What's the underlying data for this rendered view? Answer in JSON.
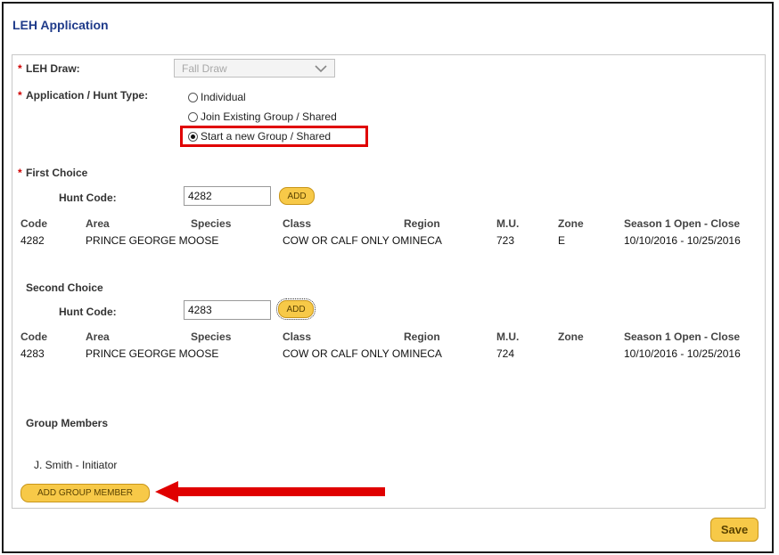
{
  "app": {
    "title": "LEH Application"
  },
  "form": {
    "required_marker": "*",
    "draw": {
      "label": "LEH Draw:",
      "value": "Fall Draw"
    },
    "hunt_type": {
      "label": "Application / Hunt Type:",
      "options": [
        {
          "label": "Individual",
          "selected": false
        },
        {
          "label": "Join Existing Group / Shared",
          "selected": false
        },
        {
          "label": "Start a new Group / Shared",
          "selected": true
        }
      ]
    }
  },
  "table_headers": [
    "Code",
    "Area",
    "Species",
    "Class",
    "Region",
    "M.U.",
    "Zone"
  ],
  "season_header": {
    "prefix": "Season ",
    "number": "1",
    "suffix": " Open - Close"
  },
  "first_choice": {
    "title": "First Choice",
    "hunt_code_label": "Hunt Code:",
    "hunt_code_value": "4282",
    "add_label": "ADD",
    "row": {
      "code": "4282",
      "area_species": "PRINCE GEORGE MOOSE",
      "class_region": "COW OR CALF ONLY OMINECA",
      "mu": "723",
      "zone": "E",
      "season": "10/10/2016 - 10/25/2016"
    }
  },
  "second_choice": {
    "title": "Second Choice",
    "hunt_code_label": "Hunt Code:",
    "hunt_code_value": "4283",
    "add_label": "ADD",
    "row": {
      "code": "4283",
      "area_species": "PRINCE GEORGE MOOSE",
      "class_region": "COW OR CALF ONLY OMINECA",
      "mu": "724",
      "zone": "",
      "season": "10/10/2016 - 10/25/2016"
    }
  },
  "group": {
    "title": "Group Members",
    "members": [
      "J. Smith - Initiator"
    ],
    "add_member_label": "ADD GROUP MEMBER"
  },
  "save_label": "Save",
  "colors": {
    "accent_title": "#1f3b8a",
    "button_yellow": "#f7c948",
    "highlight_red": "#e00000"
  },
  "icons": {
    "select_chevron": "chevron-down-icon",
    "annotation_arrow": "arrow-left-icon"
  }
}
